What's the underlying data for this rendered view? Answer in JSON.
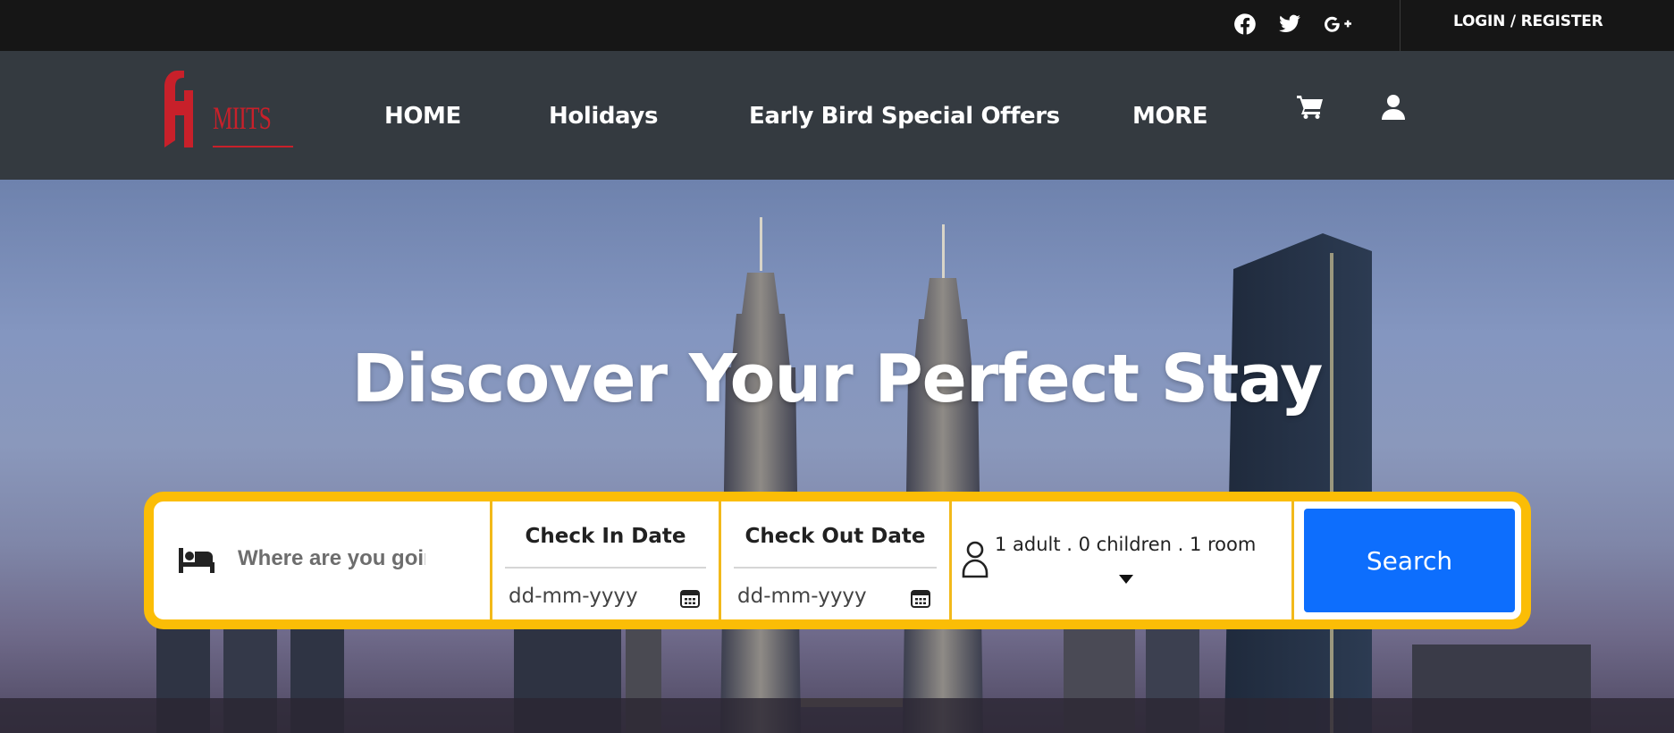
{
  "topbar": {
    "social": [
      {
        "icon": "facebook-icon"
      },
      {
        "icon": "twitter-icon"
      },
      {
        "icon": "google-plus-icon"
      }
    ],
    "login_label": "LOGIN / REGISTER"
  },
  "navbar": {
    "logo_text": "MIITS",
    "items": [
      {
        "label": "HOME"
      },
      {
        "label": "Holidays"
      },
      {
        "label": "Early Bird Special Offers"
      },
      {
        "label": "MORE"
      }
    ],
    "icons": [
      "cart-icon",
      "user-icon"
    ]
  },
  "hero": {
    "title": "Discover Your Perfect Stay"
  },
  "search": {
    "destination_placeholder": "Where are you going?",
    "check_in_label": "Check In Date",
    "check_in_placeholder": "dd-mm-yyyy",
    "check_out_label": "Check Out Date",
    "check_out_placeholder": "dd-mm-yyyy",
    "guests_summary": "1 adult . 0 children . 1 room",
    "search_label": "Search"
  },
  "colors": {
    "topbar": "#161616",
    "navbar": "#343a40",
    "accent_border": "#fbbd06",
    "search_button": "#0d6efd",
    "logo": "#c8202a"
  }
}
